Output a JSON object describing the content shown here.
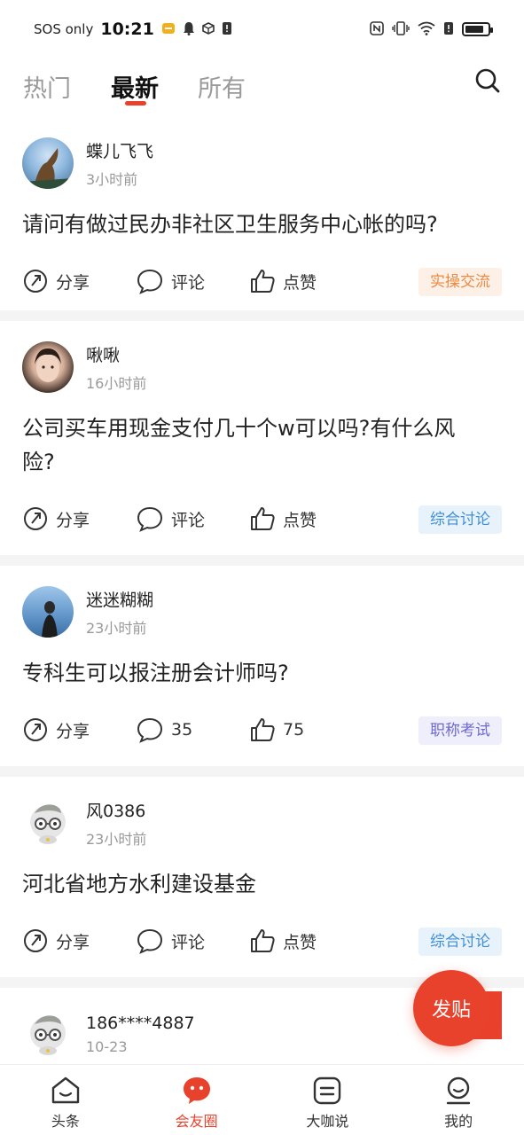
{
  "status_bar": {
    "carrier": "SOS only",
    "time": "10:21",
    "battery_level": 0.85
  },
  "top_tabs": {
    "tabs": [
      {
        "label": "热门",
        "active": false
      },
      {
        "label": "最新",
        "active": true
      },
      {
        "label": "所有",
        "active": false
      }
    ],
    "search_icon": "search-icon"
  },
  "posts": [
    {
      "username": "蝶儿飞飞",
      "time": "3小时前",
      "title": "请问有做过民办非社区卫生服务中心帐的吗?",
      "share_label": "分享",
      "comment_label": "评论",
      "like_label": "点赞",
      "tag": "实操交流",
      "tag_color": "#ec8a43"
    },
    {
      "username": "啾啾",
      "time": "16小时前",
      "title": "公司买车用现金支付几十个w可以吗?有什么风险?",
      "share_label": "分享",
      "comment_label": "评论",
      "like_label": "点赞",
      "tag": "综合讨论",
      "tag_color": "#3f8fd6"
    },
    {
      "username": "迷迷糊糊",
      "time": "23小时前",
      "title": "专科生可以报注册会计师吗?",
      "share_label": "分享",
      "comment_label": "35",
      "like_label": "75",
      "tag": "职称考试",
      "tag_color": "#6f6ad0"
    },
    {
      "username": "风0386",
      "time": "23小时前",
      "title": "河北省地方水利建设基金",
      "share_label": "分享",
      "comment_label": "评论",
      "like_label": "点赞",
      "tag": "综合讨论",
      "tag_color": "#3f8fd6"
    },
    {
      "username": "186****4887",
      "time": "10-23"
    }
  ],
  "fab": {
    "label": "发贴"
  },
  "bottom_nav": {
    "items": [
      {
        "label": "头条",
        "icon": "home-icon",
        "active": false
      },
      {
        "label": "会友圈",
        "icon": "community-icon",
        "active": true
      },
      {
        "label": "大咖说",
        "icon": "chat-icon",
        "active": false
      },
      {
        "label": "我的",
        "icon": "profile-icon",
        "active": false
      }
    ]
  },
  "colors": {
    "accent": "#e8412c"
  }
}
